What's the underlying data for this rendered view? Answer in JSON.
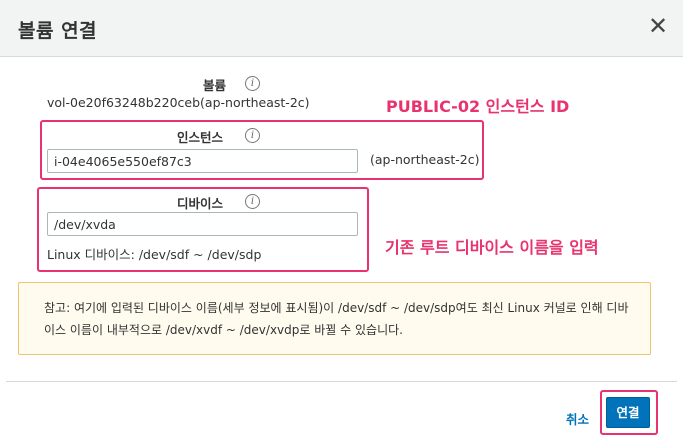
{
  "dialog": {
    "title": "볼륨 연결",
    "close_symbol": "✕"
  },
  "volume": {
    "label": "볼륨",
    "value": "vol-0e20f63248b220ceb(ap-northeast-2c)"
  },
  "instance": {
    "label": "인스턴스",
    "input_value": "i-04e4065e550ef87c3",
    "zone": "(ap-northeast-2c)"
  },
  "device": {
    "label": "디바이스",
    "input_value": "/dev/xvda",
    "hint": "Linux 디바이스: /dev/sdf ~ /dev/sdp"
  },
  "info_icon_glyph": "i",
  "annotations": {
    "instance_note": "PUBLIC-02 인스턴스 ID",
    "device_note": "기존 루트 디바이스 이름을 입력",
    "color": "#e8336e"
  },
  "warning": {
    "text": "참고: 여기에 입력된 디바이스 이름(세부 정보에 표시됨)이 /dev/sdf ~ /dev/sdp여도 최신 Linux 커널로 인해 디바이스 이름이 내부적으로 /dev/xvdf ~ /dev/xvdp로 바뀔 수 있습니다."
  },
  "footer": {
    "cancel_label": "취소",
    "connect_label": "연결"
  },
  "colors": {
    "primary": "#0073bb",
    "header_bg": "#f2f3f3",
    "warning_bg": "#fffbef",
    "warning_border": "#f0c36d"
  }
}
